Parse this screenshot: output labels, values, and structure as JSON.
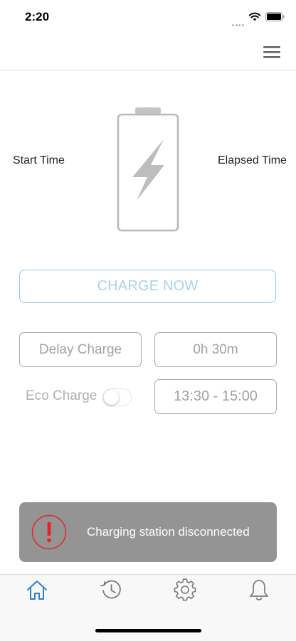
{
  "status_bar": {
    "time": "2:20"
  },
  "header": {
    "menu_icon": "hamburger-menu-icon"
  },
  "charger": {
    "start_time_label": "Start Time",
    "elapsed_time_label": "Elapsed Time",
    "battery_icon": "battery-charging-icon"
  },
  "actions": {
    "charge_now_label": "CHARGE NOW",
    "delay_charge_label": "Delay Charge",
    "delay_duration": "0h 30m",
    "eco_charge_label": "Eco Charge",
    "eco_charge_enabled": false,
    "eco_time_range": "13:30 - 15:00"
  },
  "toast": {
    "icon": "alert-icon",
    "message": "Charging station disconnected"
  },
  "tabbar": {
    "items": [
      {
        "name": "home",
        "icon": "home-icon",
        "active": true
      },
      {
        "name": "history",
        "icon": "history-icon",
        "active": false
      },
      {
        "name": "settings",
        "icon": "gear-icon",
        "active": false
      },
      {
        "name": "notifications",
        "icon": "bell-icon",
        "active": false
      }
    ]
  },
  "colors": {
    "accent": "#8ec8ea",
    "active_tab": "#2f7fcf",
    "toast_bg": "#949494",
    "alert_red": "#e0262b"
  }
}
